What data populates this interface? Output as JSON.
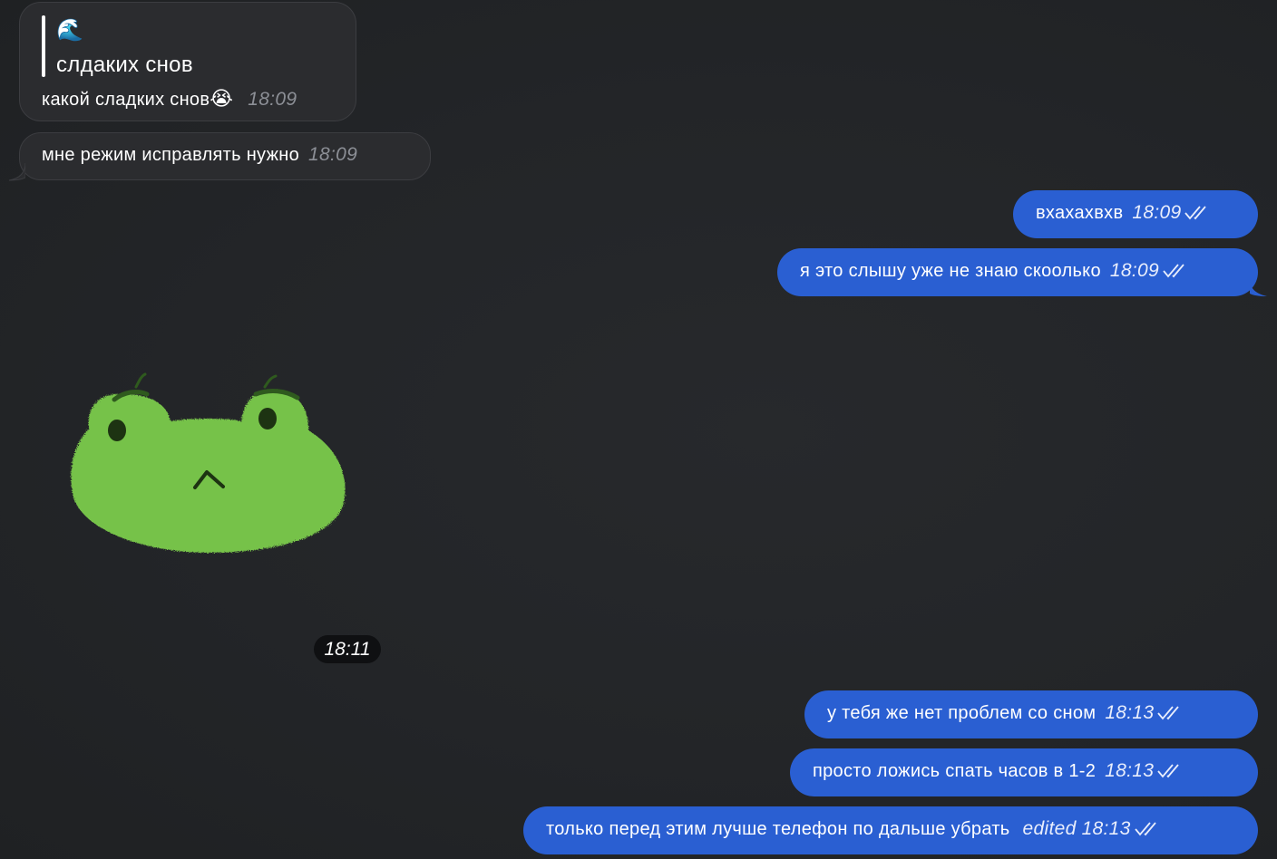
{
  "messages": {
    "m1": {
      "reply_emoji": "🌊",
      "reply_text": "слдаких снов",
      "text": "какой сладких снов",
      "emoji": "😭",
      "time": "18:09"
    },
    "m2": {
      "text": "мне режим исправлять нужно",
      "time": "18:09"
    },
    "m3": {
      "text": "вхахахвхв",
      "time": "18:09"
    },
    "m4": {
      "text": "я это слышу уже не знаю скоолько",
      "time": "18:09"
    },
    "sticker": {
      "name": "frog-sticker",
      "time": "18:11"
    },
    "m5": {
      "text": "у тебя же нет проблем со сном",
      "time": "18:13"
    },
    "m6": {
      "text": "просто ложись спать часов в 1-2",
      "time": "18:13"
    },
    "m7": {
      "text": "только перед этим лучше телефон по дальше убрать",
      "edited": "edited",
      "time": "18:13"
    }
  },
  "colors": {
    "background": "#222427",
    "incoming_bubble": "#2b2c2f",
    "outgoing_bubble": "#2a5fd2",
    "sticker_green": "#76c24a"
  },
  "icons": {
    "read_status": "double-check-icon",
    "reply_marker": "wave-emoji"
  }
}
